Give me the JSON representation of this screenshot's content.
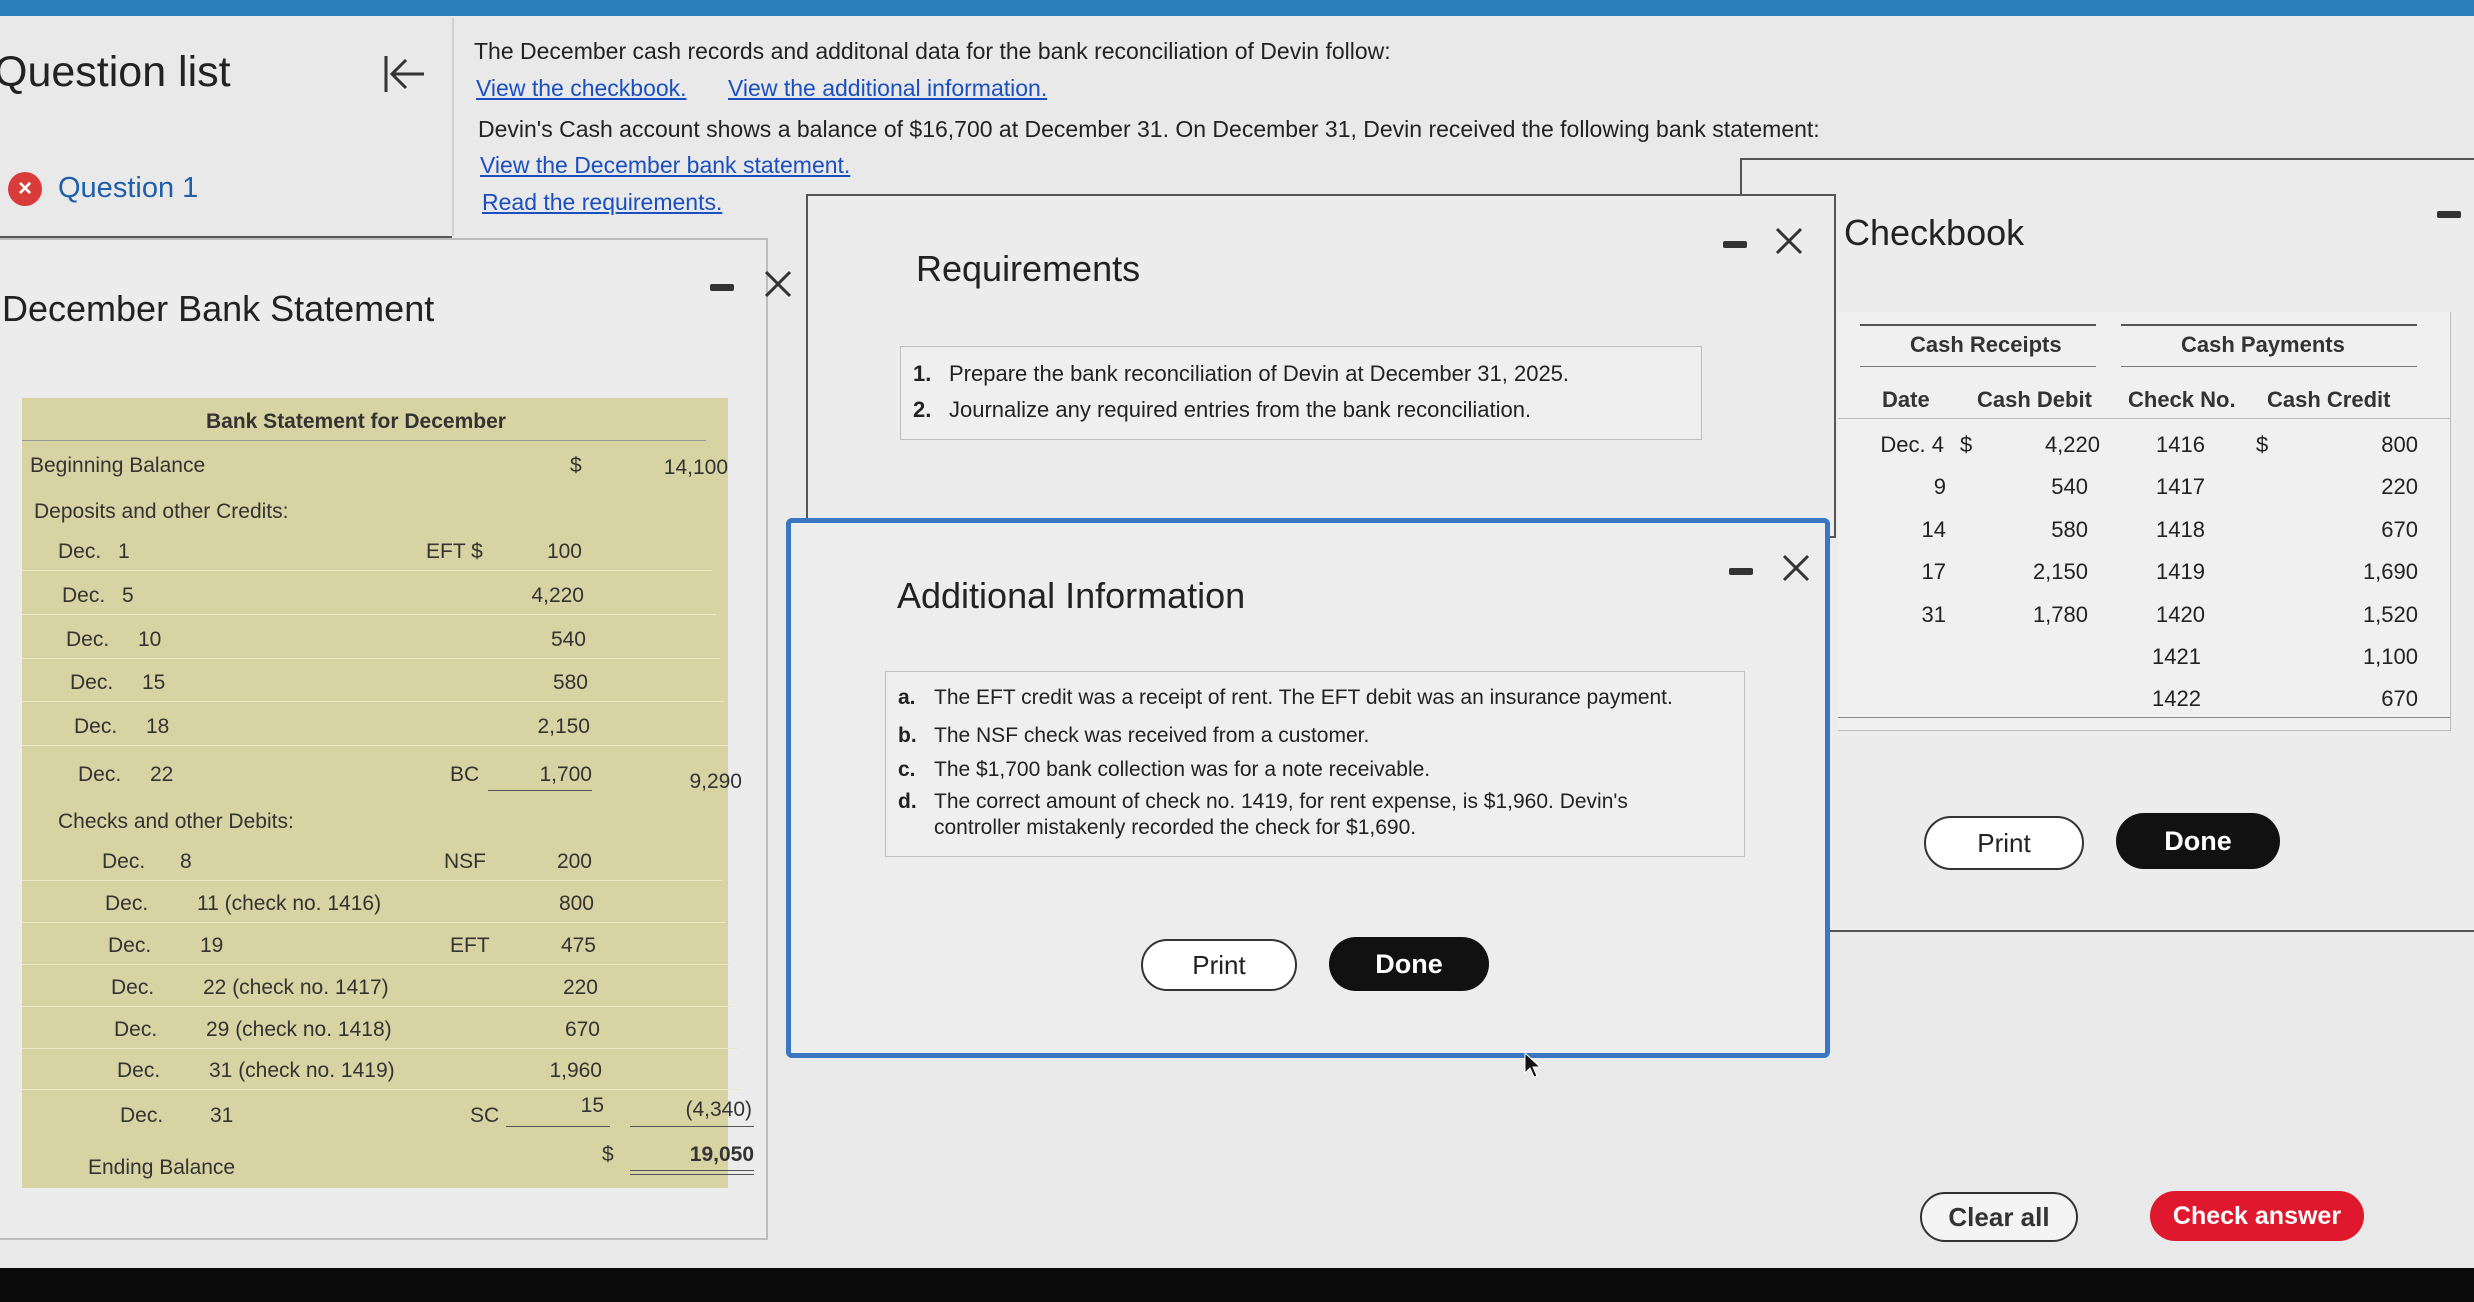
{
  "nav": {
    "title": "Question list",
    "question_label": "Question 1",
    "question_status": "×"
  },
  "problem": {
    "intro": "The December cash records and additonal data for the bank reconciliation of Devin follow:",
    "link_checkbook": "View the checkbook.",
    "link_additional": "View the additional information.",
    "balance_text": "Devin's Cash account shows a balance of $16,700 at December 31. On December 31, Devin received the following bank statement:",
    "link_statement": "View the December bank statement.",
    "link_requirements": "Read the requirements."
  },
  "bank_window": {
    "title": "December Bank Statement",
    "table_title": "Bank Statement for December",
    "beginning_label": "Beginning Balance",
    "beginning_dollar": "$",
    "beginning_value": "14,100",
    "deposits_label": "Deposits and other Credits:",
    "deposits": [
      {
        "mon": "Dec.",
        "day": "1",
        "code": "EFT $",
        "amount": "100"
      },
      {
        "mon": "Dec.",
        "day": "5",
        "code": "",
        "amount": "4,220"
      },
      {
        "mon": "Dec.",
        "day": "10",
        "code": "",
        "amount": "540"
      },
      {
        "mon": "Dec.",
        "day": "15",
        "code": "",
        "amount": "580"
      },
      {
        "mon": "Dec.",
        "day": "18",
        "code": "",
        "amount": "2,150"
      },
      {
        "mon": "Dec.",
        "day": "22",
        "code": "BC",
        "amount": "1,700"
      }
    ],
    "deposits_total": "9,290",
    "checks_label": "Checks and other Debits:",
    "checks": [
      {
        "mon": "Dec.",
        "day": "8",
        "code": "NSF",
        "amount": "200"
      },
      {
        "mon": "Dec.",
        "day": "11 (check no. 1416)",
        "code": "",
        "amount": "800"
      },
      {
        "mon": "Dec.",
        "day": "19",
        "code": "EFT",
        "amount": "475"
      },
      {
        "mon": "Dec.",
        "day": "22 (check no. 1417)",
        "code": "",
        "amount": "220"
      },
      {
        "mon": "Dec.",
        "day": "29 (check no. 1418)",
        "code": "",
        "amount": "670"
      },
      {
        "mon": "Dec.",
        "day": "31 (check no. 1419)",
        "code": "",
        "amount": "1,960"
      },
      {
        "mon": "Dec.",
        "day": "31",
        "code": "SC",
        "amount": "15"
      }
    ],
    "checks_total": "(4,340)",
    "ending_label": "Ending Balance",
    "ending_dollar": "$",
    "ending_value": "19,050"
  },
  "requirements_window": {
    "title": "Requirements",
    "items": [
      {
        "num": "1.",
        "text": "Prepare the bank reconciliation of Devin at December 31, 2025."
      },
      {
        "num": "2.",
        "text": "Journalize any required entries from the bank reconciliation."
      }
    ]
  },
  "additional_window": {
    "title": "Additional Information",
    "items": [
      {
        "num": "a.",
        "text": "The EFT credit was a receipt of rent. The EFT debit was an insurance payment."
      },
      {
        "num": "b.",
        "text": "The NSF check was received from a customer."
      },
      {
        "num": "c.",
        "text": "The $1,700 bank collection was for a note receivable."
      },
      {
        "num": "d.",
        "text": "The correct amount of check no. 1419, for rent expense, is $1,960. Devin's",
        "text2": "controller mistakenly recorded the check for $1,690."
      }
    ],
    "print_label": "Print",
    "done_label": "Done"
  },
  "checkbook_window": {
    "title": "Checkbook",
    "receipts_header": "Cash Receipts",
    "payments_header": "Cash Payments",
    "col_date": "Date",
    "col_cash_debit": "Cash Debit",
    "col_check_no": "Check No.",
    "col_cash_credit": "Cash Credit",
    "receipts": [
      {
        "date": "Dec. 4",
        "dollar": "$",
        "amount": "4,220"
      },
      {
        "date": "9",
        "dollar": "",
        "amount": "540"
      },
      {
        "date": "14",
        "dollar": "",
        "amount": "580"
      },
      {
        "date": "17",
        "dollar": "",
        "amount": "2,150"
      },
      {
        "date": "31",
        "dollar": "",
        "amount": "1,780"
      }
    ],
    "payments": [
      {
        "check": "1416",
        "dollar": "$",
        "amount": "800"
      },
      {
        "check": "1417",
        "dollar": "",
        "amount": "220"
      },
      {
        "check": "1418",
        "dollar": "",
        "amount": "670"
      },
      {
        "check": "1419",
        "dollar": "",
        "amount": "1,690"
      },
      {
        "check": "1420",
        "dollar": "",
        "amount": "1,520"
      },
      {
        "check": "1421",
        "dollar": "",
        "amount": "1,100"
      },
      {
        "check": "1422",
        "dollar": "",
        "amount": "670"
      }
    ],
    "print_label": "Print",
    "done_label": "Done"
  },
  "footer": {
    "clear_all": "Clear all",
    "check_answer": "Check answer"
  },
  "colors": {
    "accent_blue": "#2a7fb8",
    "link_blue": "#1a4fbf",
    "statement_bg": "#d8d3a2",
    "check_answer_red": "#e0182d",
    "error_red": "#d93a3a"
  }
}
